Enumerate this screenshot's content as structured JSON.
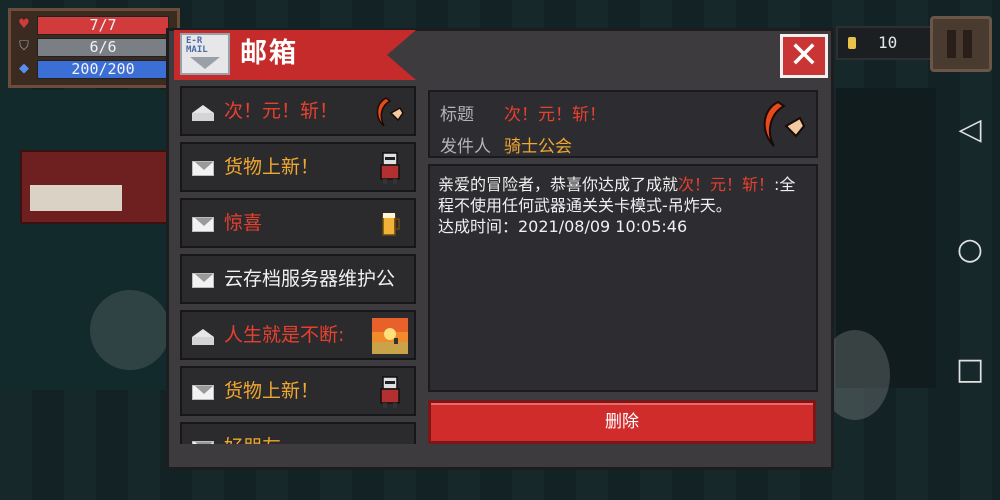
{
  "hud": {
    "health": "7/7",
    "armor": "6/6",
    "energy": "200/200",
    "health_color": "#d23b3b",
    "armor_color": "#7a7f86",
    "energy_color": "#3b6fd6"
  },
  "coins": {
    "icon": "coin-icon",
    "value": "10"
  },
  "mailbox": {
    "title": "邮箱",
    "icon_label": "E-R\nMAIL",
    "close_icon": "close-icon"
  },
  "mail_list": [
    {
      "subject": "次！元！斩！",
      "color": "#e8402f",
      "read": true,
      "thumb": "crescent-blade-icon"
    },
    {
      "subject": "货物上新！",
      "color": "#f0a830",
      "read": false,
      "thumb": "merchant-icon"
    },
    {
      "subject": "惊喜",
      "color": "#e8402f",
      "read": false,
      "thumb": "beer-icon"
    },
    {
      "subject": "云存档服务器维护公",
      "color": "#f0f0f0",
      "read": false,
      "thumb": ""
    },
    {
      "subject": "人生就是不断:",
      "color": "#e8402f",
      "read": true,
      "thumb": "sunset-icon"
    },
    {
      "subject": "货物上新！",
      "color": "#f0a830",
      "read": false,
      "thumb": "merchant-icon"
    },
    {
      "subject": "好朋友",
      "color": "#f0a830",
      "read": false,
      "thumb": ""
    }
  ],
  "detail": {
    "title_label": "标题",
    "title_value": "次！元！斩！",
    "sender_label": "发件人",
    "sender_value": "骑士公会",
    "body_intro": "亲爱的冒险者，恭喜你达成了成就",
    "body_highlight": "次！元！斩！",
    "body_rest": ":全程不使用任何武器通关关卡模式-吊炸天。",
    "body_time": "达成时间：2021/08/09 10:05:46",
    "delete_label": "删除"
  },
  "colors": {
    "red": "#e8402f",
    "gold": "#f0a830"
  },
  "android_nav": {
    "back": "◁",
    "home": "○",
    "recent": "□"
  }
}
